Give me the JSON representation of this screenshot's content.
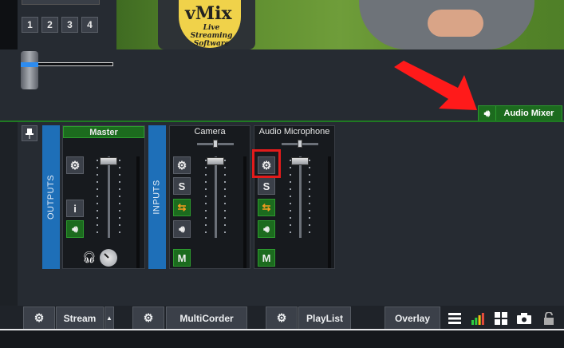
{
  "preview": {
    "number_buttons": [
      "1",
      "2",
      "3",
      "4"
    ],
    "logo_text": "vMix",
    "logo_subtext": "Live Streaming Software"
  },
  "audio_mixer_toggle": {
    "label": "Audio Mixer",
    "icon": "speaker-icon"
  },
  "outputs_label": "OUTPUTS",
  "inputs_label": "INPUTS",
  "master": {
    "title": "Master",
    "info_label": "i",
    "headphone_icon": "headphones-icon"
  },
  "channels": [
    {
      "title": "Camera",
      "solo_label": "S",
      "mute_label": "M"
    },
    {
      "title": "Audio Microphone",
      "solo_label": "S",
      "mute_label": "M"
    }
  ],
  "bottom_bar": {
    "stream_label": "Stream",
    "multicorder_label": "MultiCorder",
    "playlist_label": "PlayList",
    "overlay_label": "Overlay"
  },
  "colors": {
    "accent_green": "#1c6b1e",
    "vertical_bar_blue": "#1e6fb8",
    "highlight_red": "#e21b1b",
    "arrow_red": "#ff1a1a"
  }
}
